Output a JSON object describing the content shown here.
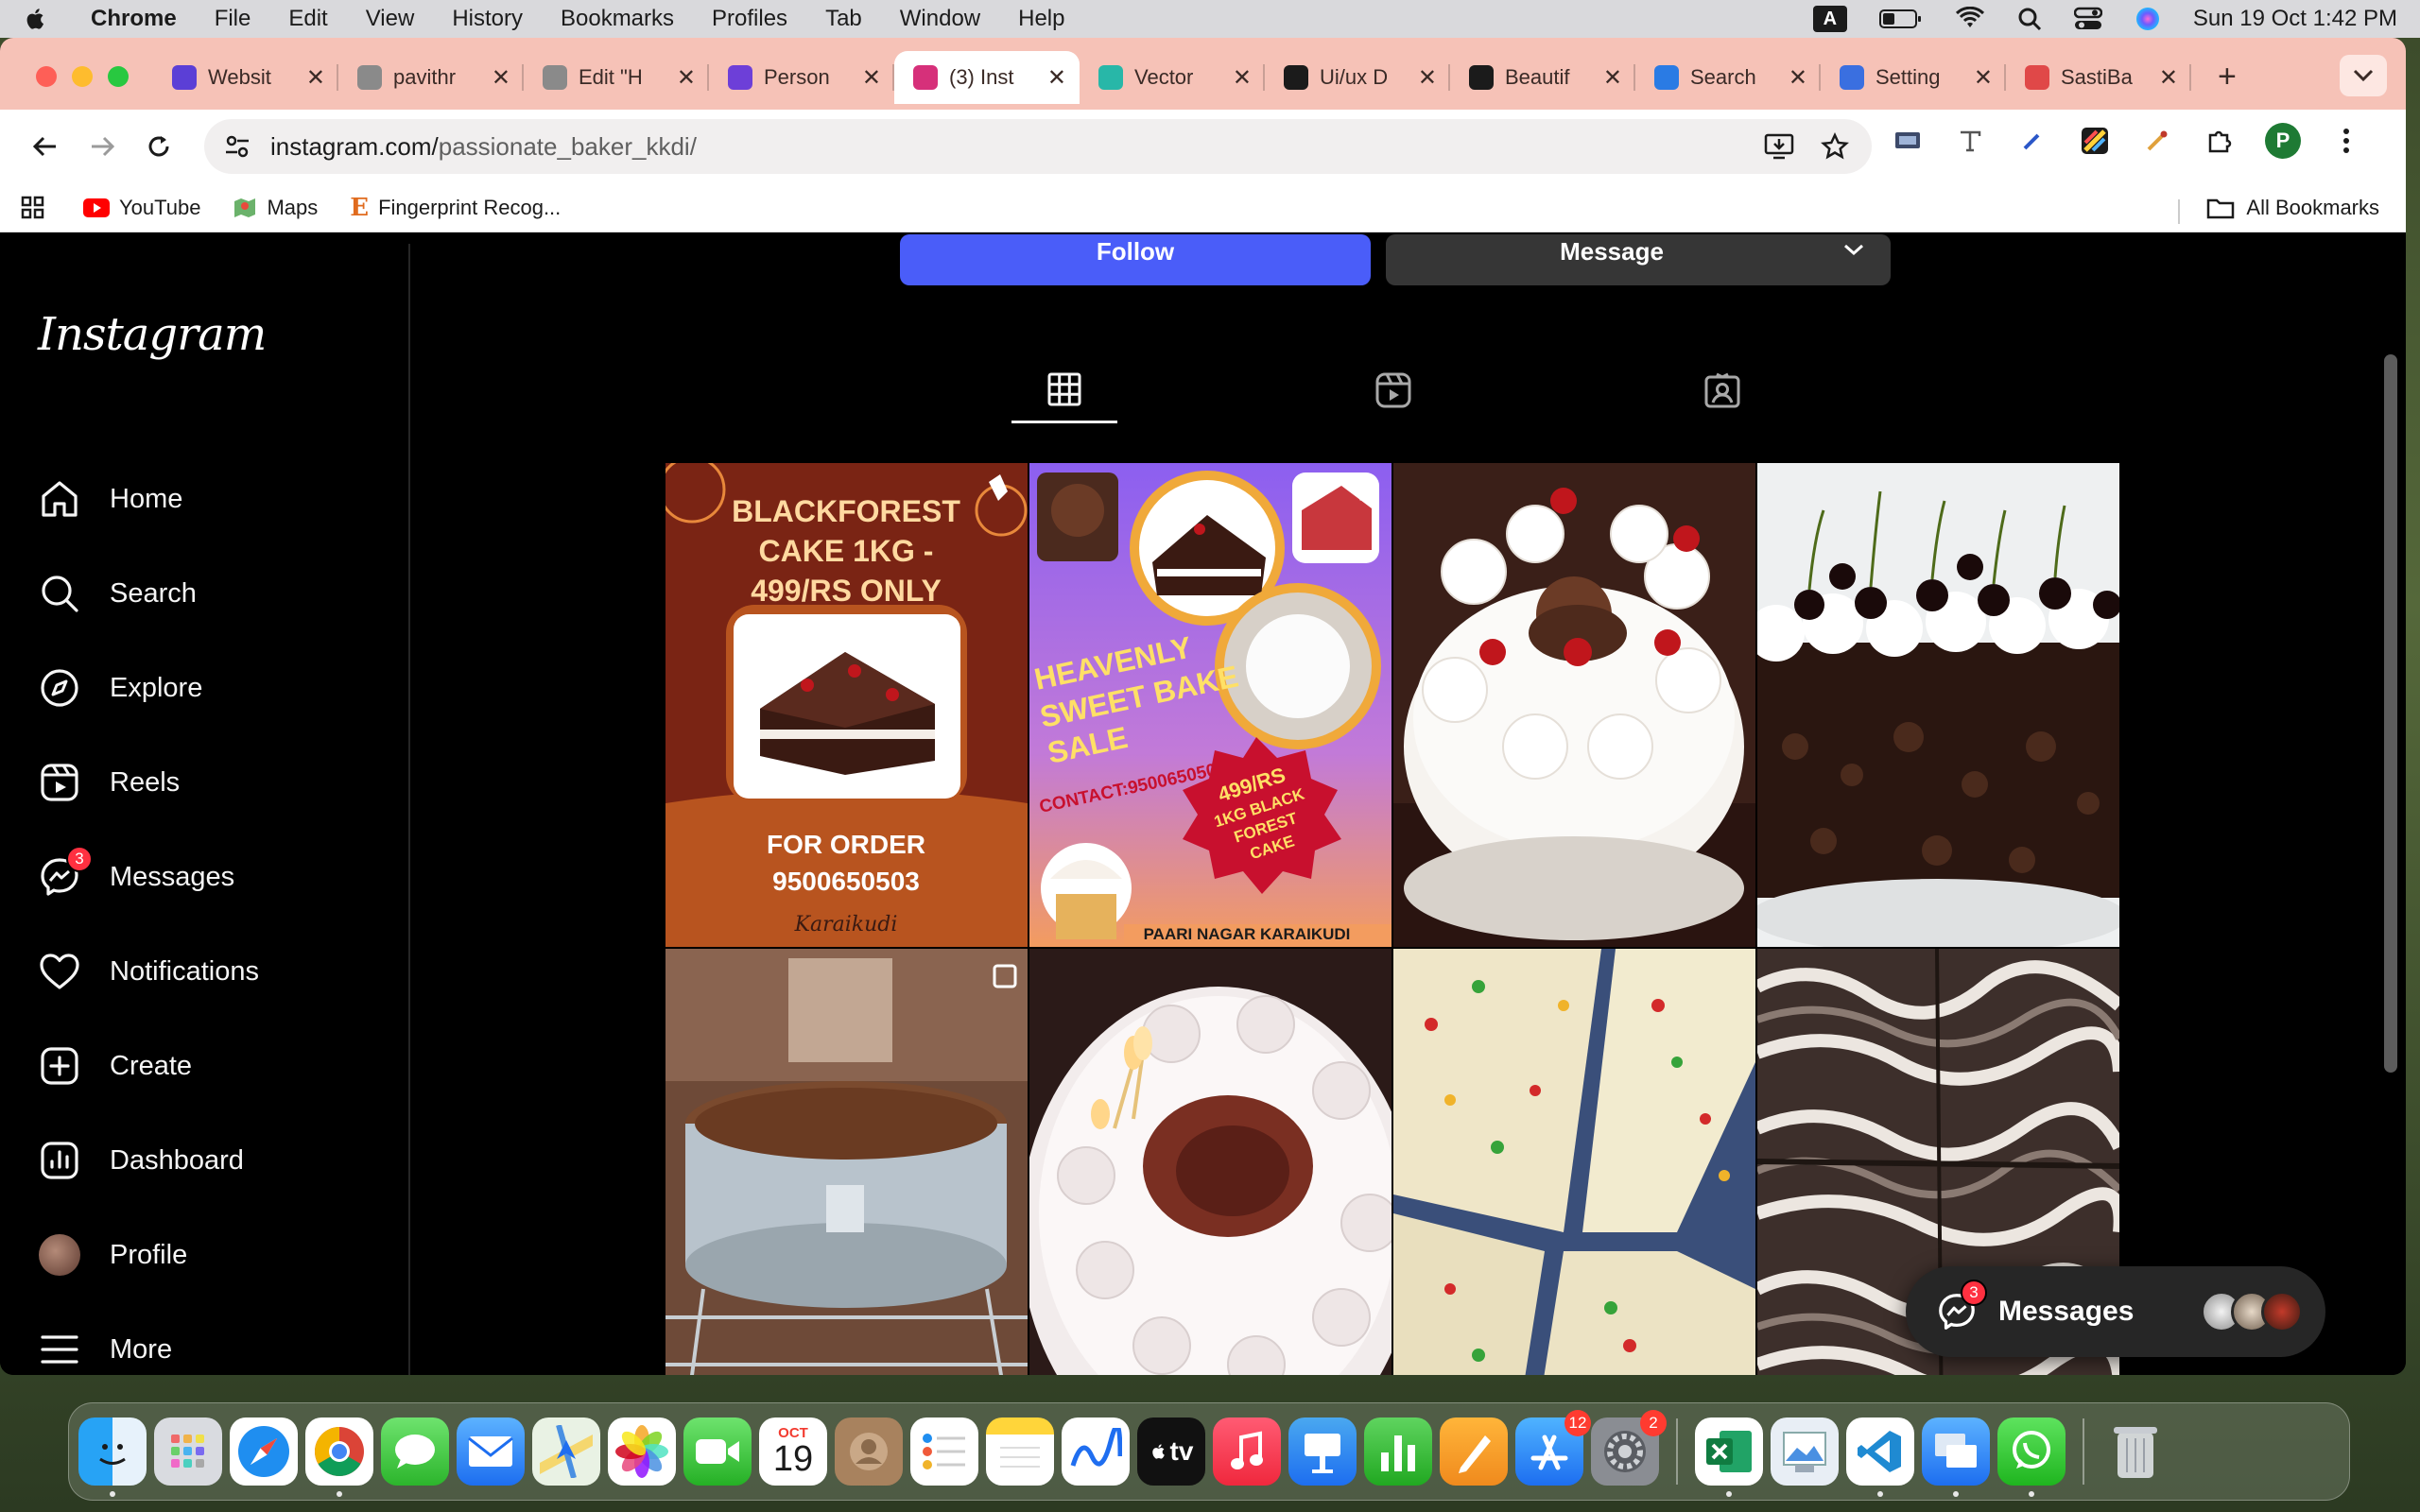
{
  "menubar": {
    "app": "Chrome",
    "items": [
      "File",
      "Edit",
      "View",
      "History",
      "Bookmarks",
      "Profiles",
      "Tab",
      "Window",
      "Help"
    ],
    "input_badge": "A",
    "clock": "Sun 19 Oct  1:42 PM"
  },
  "browser": {
    "tabs": [
      {
        "label": "Websit",
        "color": "#5b3fd6"
      },
      {
        "label": "pavithr",
        "color": "#8a8a8a"
      },
      {
        "label": "Edit \"H",
        "color": "#8a8a8a"
      },
      {
        "label": "Person",
        "color": "#6d3fd8"
      },
      {
        "label": "(3) Inst",
        "color": "#d6307a"
      },
      {
        "label": "Vector",
        "color": "#28b7a8"
      },
      {
        "label": "Ui/ux D",
        "color": "#1b1b1b"
      },
      {
        "label": "Beautif",
        "color": "#1b1b1b"
      },
      {
        "label": "Search",
        "color": "#2a7be4"
      },
      {
        "label": "Setting",
        "color": "#3a6fe0"
      },
      {
        "label": "SastiBa",
        "color": "#e04848"
      }
    ],
    "url_host": "instagram.com/",
    "url_path": "passionate_baker_kkdi/",
    "profile_initial": "P",
    "bookmarks": [
      {
        "label": "YouTube"
      },
      {
        "label": "Maps"
      },
      {
        "label": "Fingerprint Recog..."
      }
    ],
    "all_bookmarks": "All Bookmarks"
  },
  "instagram": {
    "logo": "Instagram",
    "nav": [
      {
        "label": "Home",
        "icon": "home-icon"
      },
      {
        "label": "Search",
        "icon": "search-icon"
      },
      {
        "label": "Explore",
        "icon": "explore-icon"
      },
      {
        "label": "Reels",
        "icon": "reels-icon"
      },
      {
        "label": "Messages",
        "icon": "messages-icon",
        "badge": "3"
      },
      {
        "label": "Notifications",
        "icon": "heart-icon"
      },
      {
        "label": "Create",
        "icon": "create-icon"
      },
      {
        "label": "Dashboard",
        "icon": "dashboard-icon"
      },
      {
        "label": "Profile",
        "icon": "profile-avatar"
      },
      {
        "label": "More",
        "icon": "menu-icon"
      }
    ],
    "follow_label": "Follow",
    "message_label": "Message",
    "posts": [
      {
        "title_lines": [
          "BLACKFOREST",
          "CAKE 1KG -",
          "499/RS ONLY"
        ],
        "order_lines": [
          "FOR ORDER",
          "9500650503"
        ],
        "signature": "Karaikudi"
      },
      {
        "headline_lines": [
          "HEAVENLY",
          "SWEET BAKE",
          "SALE"
        ],
        "contact": "CONTACT:9500650503",
        "seal_lines": [
          "499/RS",
          "1KG BLACK",
          "FOREST",
          "CAKE"
        ],
        "footer": "PAARI NAGAR KARAIKUDI"
      }
    ],
    "messages_pill": {
      "label": "Messages",
      "badge": "3"
    }
  },
  "dock": {
    "calendar_month": "OCT",
    "calendar_day": "19",
    "appstore_badge": "12",
    "settings_badge": "2",
    "tv_label": "tv"
  }
}
